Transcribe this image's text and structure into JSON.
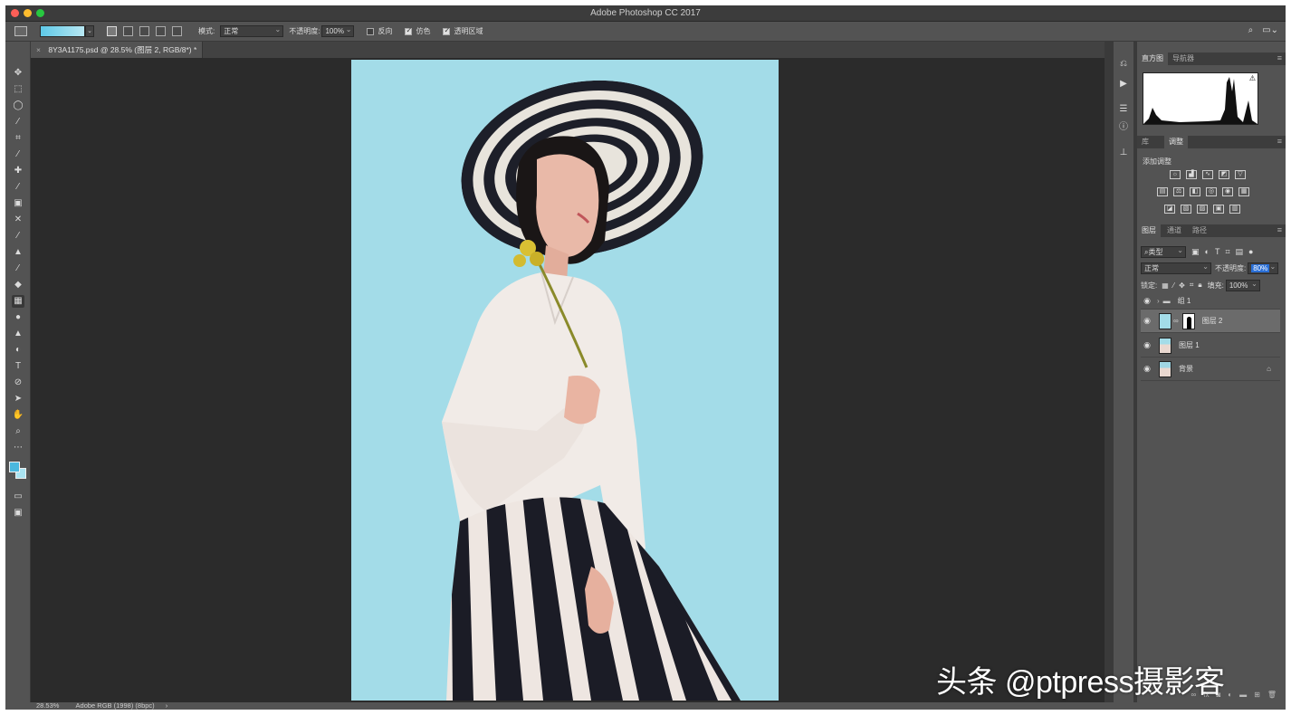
{
  "window": {
    "title": "Adobe Photoshop CC 2017"
  },
  "options_bar": {
    "mode_label": "模式:",
    "mode_value": "正常",
    "opacity_label": "不透明度:",
    "opacity_value": "100%",
    "reverse_label": "反向",
    "dither_label": "仿色",
    "transparency_label": "透明区域",
    "gradient_colors": [
      "#5ec9e8",
      "#b8e8f3"
    ]
  },
  "document": {
    "tab_title": "8Y3A1175.psd @ 28.5% (图层 2, RGB/8*) *"
  },
  "toolbar": {
    "foreground_color": "#4bb8de",
    "background_color": "#a9e3f1"
  },
  "panels": {
    "top_tabs": [
      "直方图",
      "导航器"
    ],
    "mid_tabs": [
      "库",
      "调整"
    ],
    "adjust_label": "添加调整",
    "layer_tabs": [
      "图层",
      "通道",
      "路径"
    ],
    "filter_kind": "类型",
    "blend_mode": "正常",
    "opacity_label": "不透明度:",
    "opacity_value": "80%",
    "lock_label": "锁定:",
    "fill_label": "填充:",
    "fill_value": "100%",
    "layers": [
      {
        "name": "组 1",
        "type": "group"
      },
      {
        "name": "图层 2",
        "type": "layer-mask",
        "selected": true
      },
      {
        "name": "图层 1",
        "type": "layer"
      },
      {
        "name": "背景",
        "type": "background"
      }
    ]
  },
  "status": {
    "zoom": "28.53%",
    "profile": "Adobe RGB (1998) (8bpc)"
  },
  "watermark": {
    "text": "头条 @ptpress摄影客"
  }
}
